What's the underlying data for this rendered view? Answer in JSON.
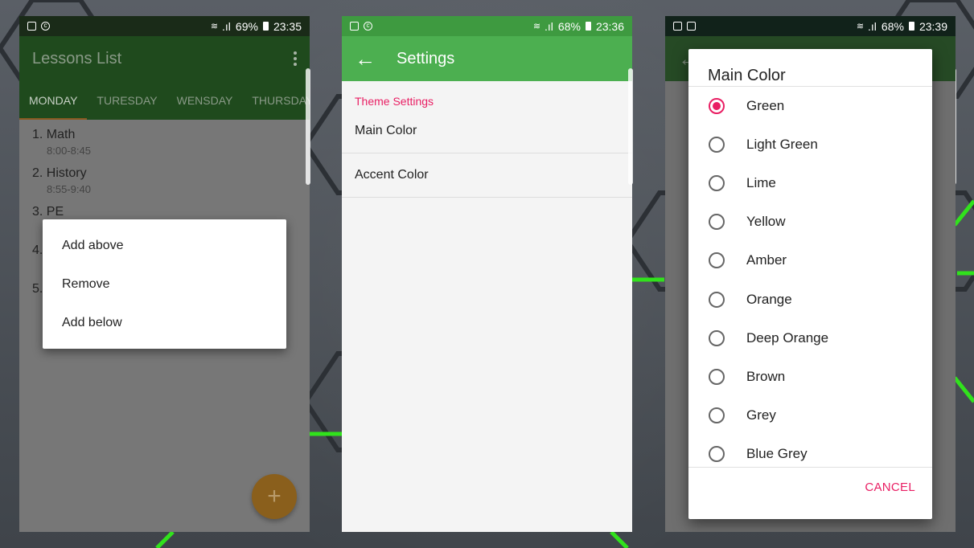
{
  "screen1": {
    "status": {
      "battery": "69%",
      "time": "23:35"
    },
    "title": "Lessons List",
    "tabs": [
      "MONDAY",
      "TURESDAY",
      "WENSDAY",
      "THURSDAY"
    ],
    "lessons": [
      {
        "name": "1. Math",
        "time": "8:00-8:45"
      },
      {
        "name": "2. History",
        "time": "8:55-9:40"
      },
      {
        "name": "3. PE",
        "time": ""
      }
    ],
    "hidden_numbers": [
      "4.",
      "5."
    ],
    "menu": [
      "Add above",
      "Remove",
      "Add below"
    ],
    "fab_label": "+"
  },
  "screen2": {
    "status": {
      "battery": "68%",
      "time": "23:36"
    },
    "title": "Settings",
    "category": "Theme Settings",
    "items": [
      "Main Color",
      "Accent Color"
    ]
  },
  "screen3": {
    "status": {
      "battery": "68%",
      "time": "23:39"
    },
    "dialog_title": "Main Color",
    "options": [
      "Green",
      "Light Green",
      "Lime",
      "Yellow",
      "Amber",
      "Orange",
      "Deep Orange",
      "Brown",
      "Grey",
      "Blue Grey"
    ],
    "selected": "Green",
    "cancel": "CANCEL"
  },
  "colors": {
    "primary": "#4caf50",
    "accent": "#e91e63",
    "fab": "#ff9800"
  }
}
